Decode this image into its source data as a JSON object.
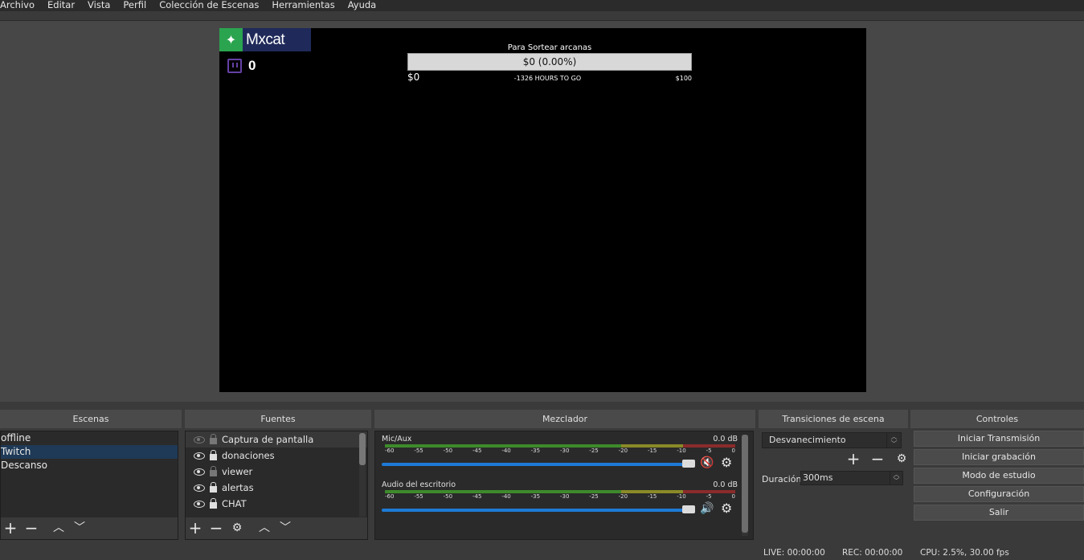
{
  "menu": [
    "Archivo",
    "Editar",
    "Vista",
    "Perfil",
    "Colección de Escenas",
    "Herramientas",
    "Ayuda"
  ],
  "overlay": {
    "brand_name": "Mxcat",
    "twitch_count": "0",
    "goal": {
      "title": "Para Sortear arcanas",
      "amount": "$0 (0.00%)",
      "progress_fraction": 0.0,
      "start": "$0",
      "remaining": "-1326 HOURS TO GO",
      "end": "$100"
    }
  },
  "docks": {
    "scenes_title": "Escenas",
    "sources_title": "Fuentes",
    "mixer_title": "Mezclador",
    "transitions_title": "Transiciones de escena",
    "controls_title": "Controles"
  },
  "scenes": [
    "offline",
    "Twitch",
    "Descanso"
  ],
  "sources": [
    "Captura de pantalla",
    "donaciones",
    "viewer",
    "alertas",
    "CHAT"
  ],
  "mixer": {
    "ticks": [
      "-60",
      "-55",
      "-50",
      "-45",
      "-40",
      "-35",
      "-30",
      "-25",
      "-20",
      "-15",
      "-10",
      "-5",
      "0"
    ],
    "channels": [
      {
        "name": "Mic/Aux",
        "db": "0.0 dB",
        "muted": true,
        "volume_fraction": 1.0
      },
      {
        "name": "Audio del escritorio",
        "db": "0.0 dB",
        "muted": false,
        "volume_fraction": 1.0
      }
    ]
  },
  "transitions": {
    "selected": "Desvanecimiento",
    "duration_label": "Duración",
    "duration_value": "300ms"
  },
  "controls": [
    "Iniciar Transmisión",
    "Iniciar grabación",
    "Modo de estudio",
    "Configuración",
    "Salir"
  ],
  "status": {
    "live": "LIVE: 00:00:00",
    "rec": "REC: 00:00:00",
    "cpu": "CPU: 2.5%, 30.00 fps"
  }
}
